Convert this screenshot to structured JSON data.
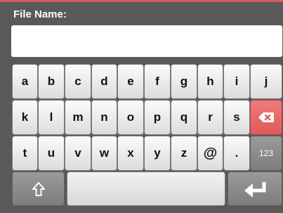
{
  "field": {
    "label": "File Name:",
    "value": ""
  },
  "keyboard": {
    "row1": [
      "a",
      "b",
      "c",
      "d",
      "e",
      "f",
      "g",
      "h",
      "i",
      "j"
    ],
    "row2": [
      "k",
      "l",
      "m",
      "n",
      "o",
      "p",
      "q",
      "r",
      "s"
    ],
    "row3": [
      "t",
      "u",
      "v",
      "w",
      "x",
      "y",
      "z",
      "@",
      "."
    ],
    "numbers_key": "123",
    "icons": {
      "backspace": "backspace-icon",
      "shift": "shift-arrow-icon",
      "enter": "enter-arrow-icon"
    }
  },
  "colors": {
    "background": "#595959",
    "accent": "#d85a5a",
    "key": "#f2f2f2",
    "dark_key": "#8a8a8a"
  }
}
